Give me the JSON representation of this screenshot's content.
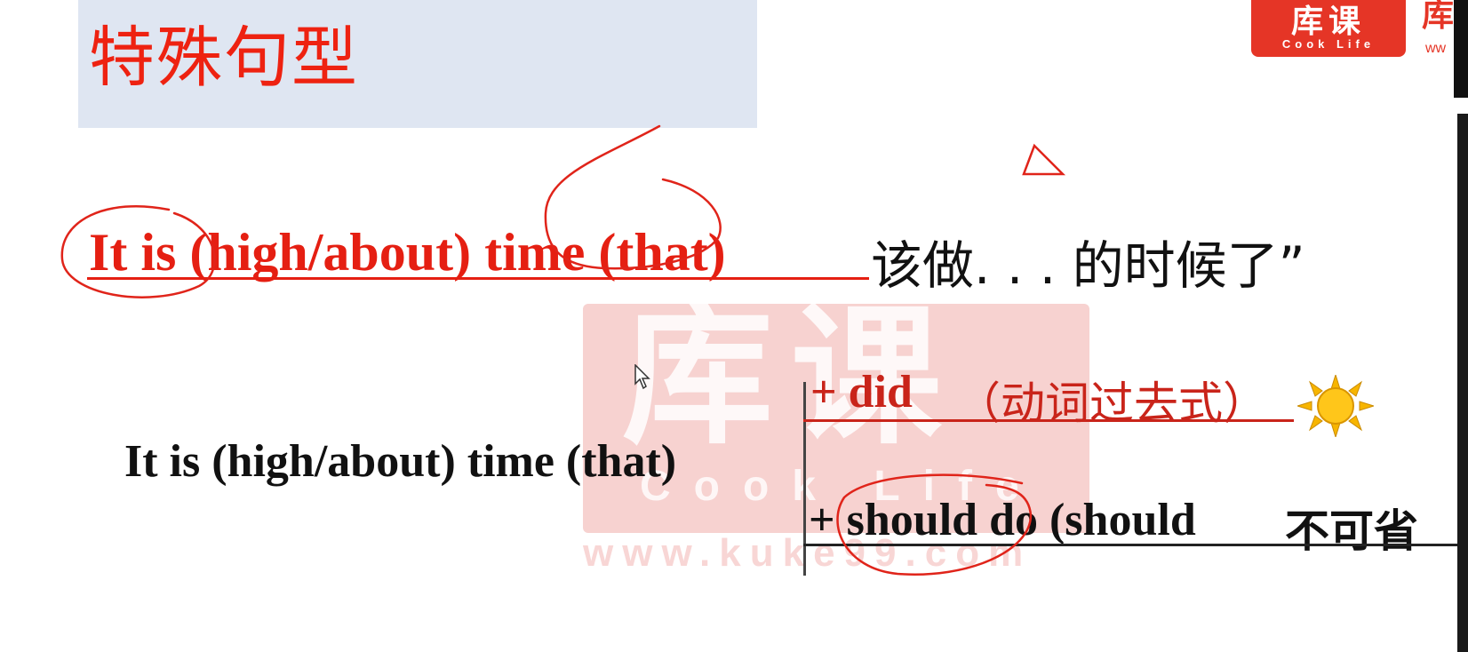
{
  "slide": {
    "title": "特殊句型",
    "line1_en": "It is (high/about) time (that)",
    "line1_cn": "该做. . . 的时候了”",
    "line2": "It is (high/about) time (that)",
    "option1_en": "+ did",
    "option1_cn": "（动词过去式）",
    "option2_en": "+ should do (should",
    "option2_cn": "不可省"
  },
  "logo": {
    "cn": "库课",
    "en": "Cook Life",
    "edge_cn": "库",
    "edge_en": "ww"
  },
  "watermark": {
    "cn": "库课",
    "en": "Cook Life",
    "url": "www.kuke99.com"
  },
  "icons": [
    "sun-icon",
    "cursor-icon"
  ],
  "colors": {
    "title_red": "#ee2211",
    "highlight_red": "#e51f12",
    "title_bg": "#dfe6f2",
    "brand_red": "#e53526"
  }
}
